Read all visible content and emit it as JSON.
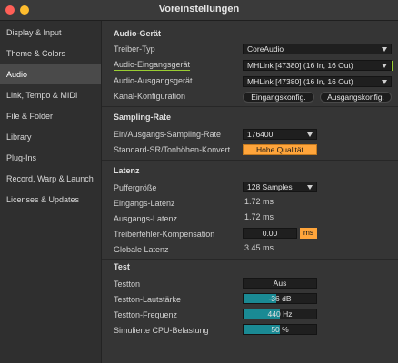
{
  "window": {
    "title": "Voreinstellungen"
  },
  "sidebar": {
    "items": [
      {
        "label": "Display & Input",
        "active": false
      },
      {
        "label": "Theme & Colors",
        "active": false
      },
      {
        "label": "Audio",
        "active": true
      },
      {
        "label": "Link, Tempo & MIDI",
        "active": false
      },
      {
        "label": "File & Folder",
        "active": false
      },
      {
        "label": "Library",
        "active": false
      },
      {
        "label": "Plug-Ins",
        "active": false
      },
      {
        "label": "Record, Warp & Launch",
        "active": false
      },
      {
        "label": "Licenses & Updates",
        "active": false
      }
    ]
  },
  "audio_device": {
    "heading": "Audio-Gerät",
    "driver_type_label": "Treiber-Typ",
    "driver_type_value": "CoreAudio",
    "input_device_label": "Audio-Eingangsgerät",
    "input_device_value": "MHLink [47380] (16 In, 16 Out)",
    "output_device_label": "Audio-Ausgangsgerät",
    "output_device_value": "MHLink [47380] (16 In, 16 Out)",
    "channel_config_label": "Kanal-Konfiguration",
    "input_config_button": "Eingangskonfig.",
    "output_config_button": "Ausgangskonfig."
  },
  "sample_rate": {
    "heading": "Sampling-Rate",
    "io_rate_label": "Ein/Ausgangs-Sampling-Rate",
    "io_rate_value": "176400",
    "default_sr_label": "Standard-SR/Tonhöhen-Konvert.",
    "default_sr_value": "Hohe Qualität"
  },
  "latency": {
    "heading": "Latenz",
    "buffer_label": "Puffergröße",
    "buffer_value": "128 Samples",
    "input_latency_label": "Eingangs-Latenz",
    "input_latency_value": "1.72 ms",
    "output_latency_label": "Ausgangs-Latenz",
    "output_latency_value": "1.72 ms",
    "driver_comp_label": "Treiberfehler-Kompensation",
    "driver_comp_value": "0.00",
    "driver_comp_unit": "ms",
    "overall_latency_label": "Globale Latenz",
    "overall_latency_value": "3.45 ms"
  },
  "test": {
    "heading": "Test",
    "tone_label": "Testton",
    "tone_value": "Aus",
    "volume_label": "Testton-Lautstärke",
    "volume_value": "-36 dB",
    "volume_fraction": 0.45,
    "frequency_label": "Testton-Frequenz",
    "frequency_value": "440 Hz",
    "frequency_fraction": 0.5,
    "cpu_label": "Simulierte CPU-Belastung",
    "cpu_value": "50 %",
    "cpu_fraction": 0.5
  },
  "colors": {
    "accent_orange": "#ffa53b",
    "meter_teal": "#1a8a94",
    "focus_green": "#9acd32"
  }
}
